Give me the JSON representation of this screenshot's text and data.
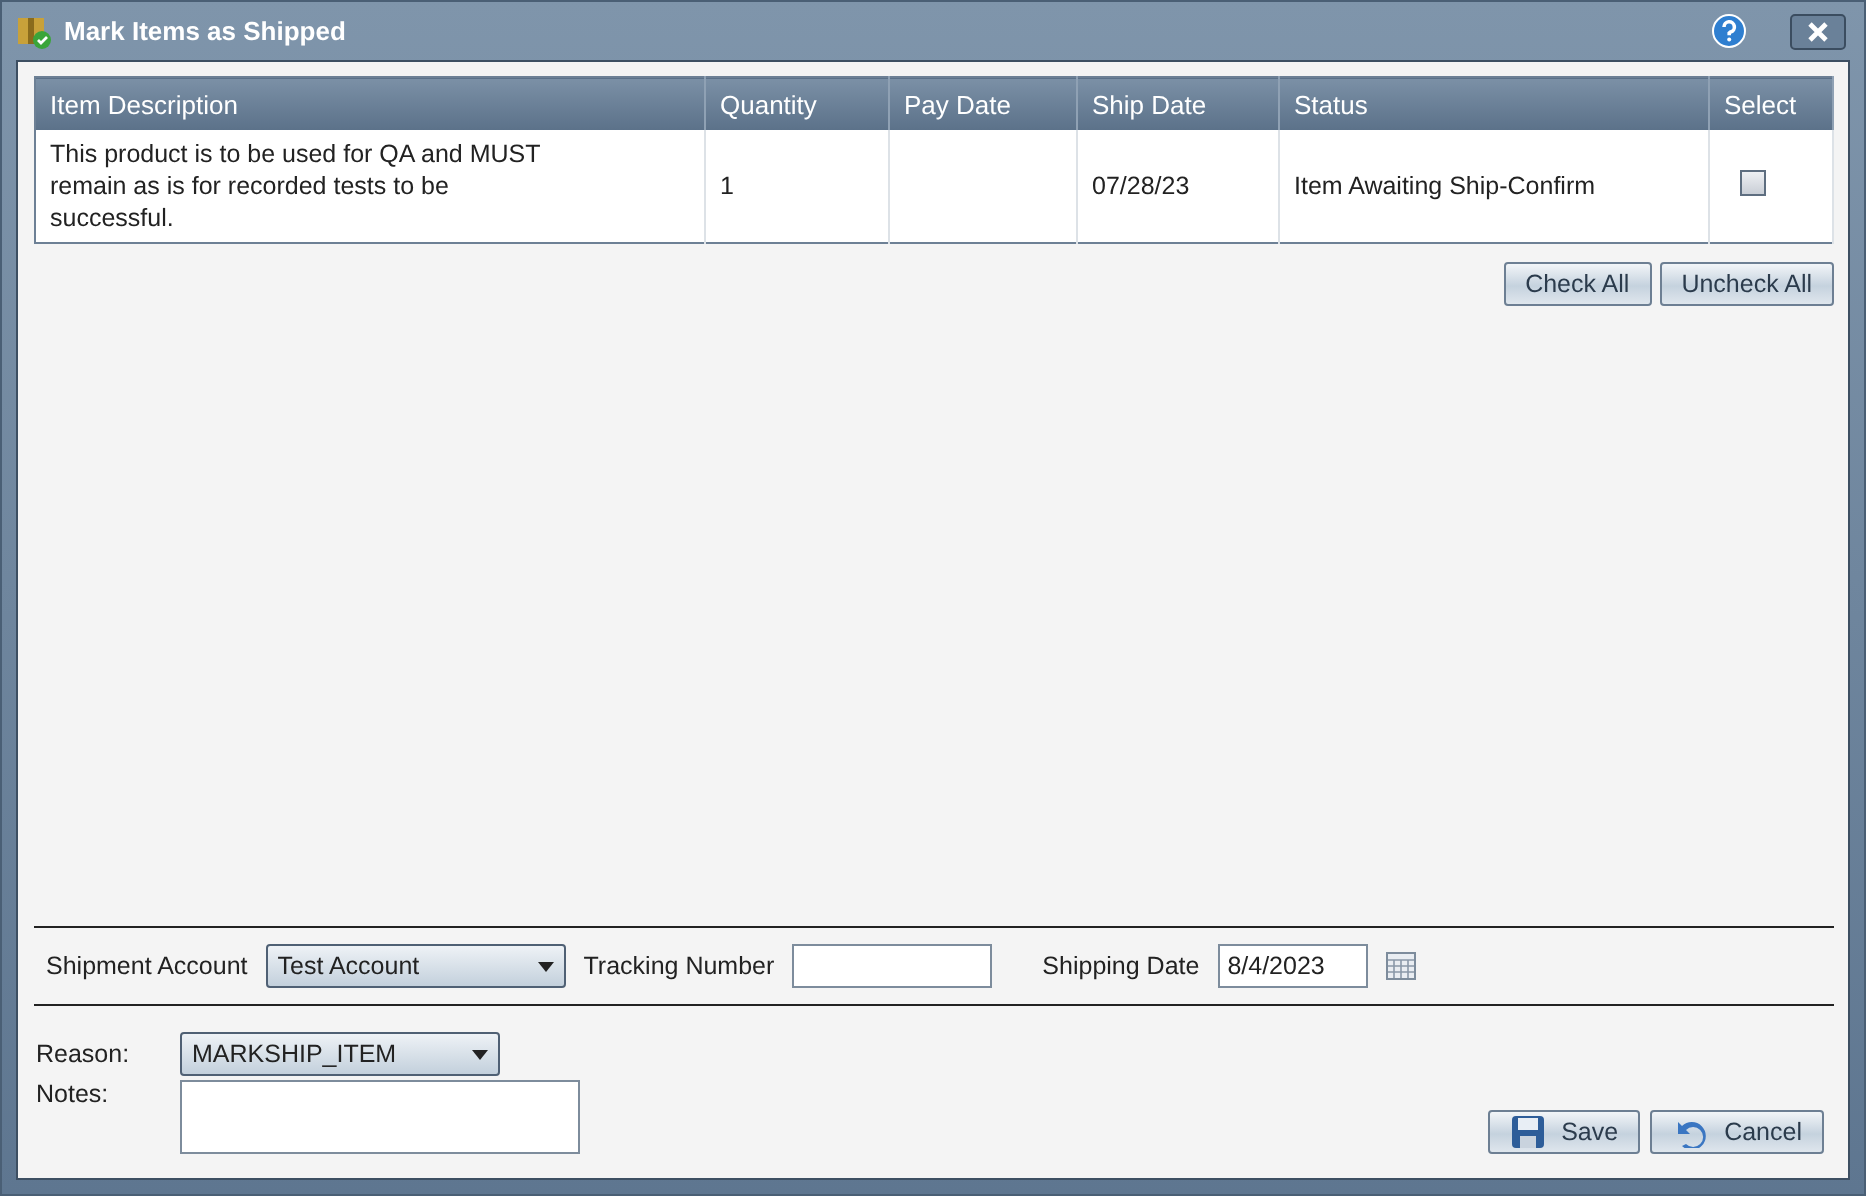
{
  "window": {
    "title": "Mark Items as Shipped"
  },
  "table": {
    "columns": [
      "Item Description",
      "Quantity",
      "Pay Date",
      "Ship Date",
      "Status",
      "Select"
    ],
    "rows": [
      {
        "description": "This product is to be used for QA and MUST remain as is for recorded tests to be successful.",
        "quantity": "1",
        "ship_date": "07/28/23",
        "status": "Item Awaiting Ship-Confirm",
        "checked": false
      }
    ]
  },
  "table_buttons": [
    "Check All",
    "Uncheck All"
  ],
  "shipment": {
    "account_label": "Shipment Account",
    "account_value": "Test Account",
    "tracking_label": "Tracking Number",
    "date_label": "Shipping Date",
    "date_value": "8/4/2023"
  },
  "reason": {
    "label": "Reason:",
    "value": "MARKSHIP_ITEM"
  },
  "notes": {
    "label": "Notes:"
  },
  "actions": [
    {
      "label": "Save",
      "kind": "save"
    },
    {
      "label": "Cancel",
      "kind": "cancel"
    }
  ]
}
